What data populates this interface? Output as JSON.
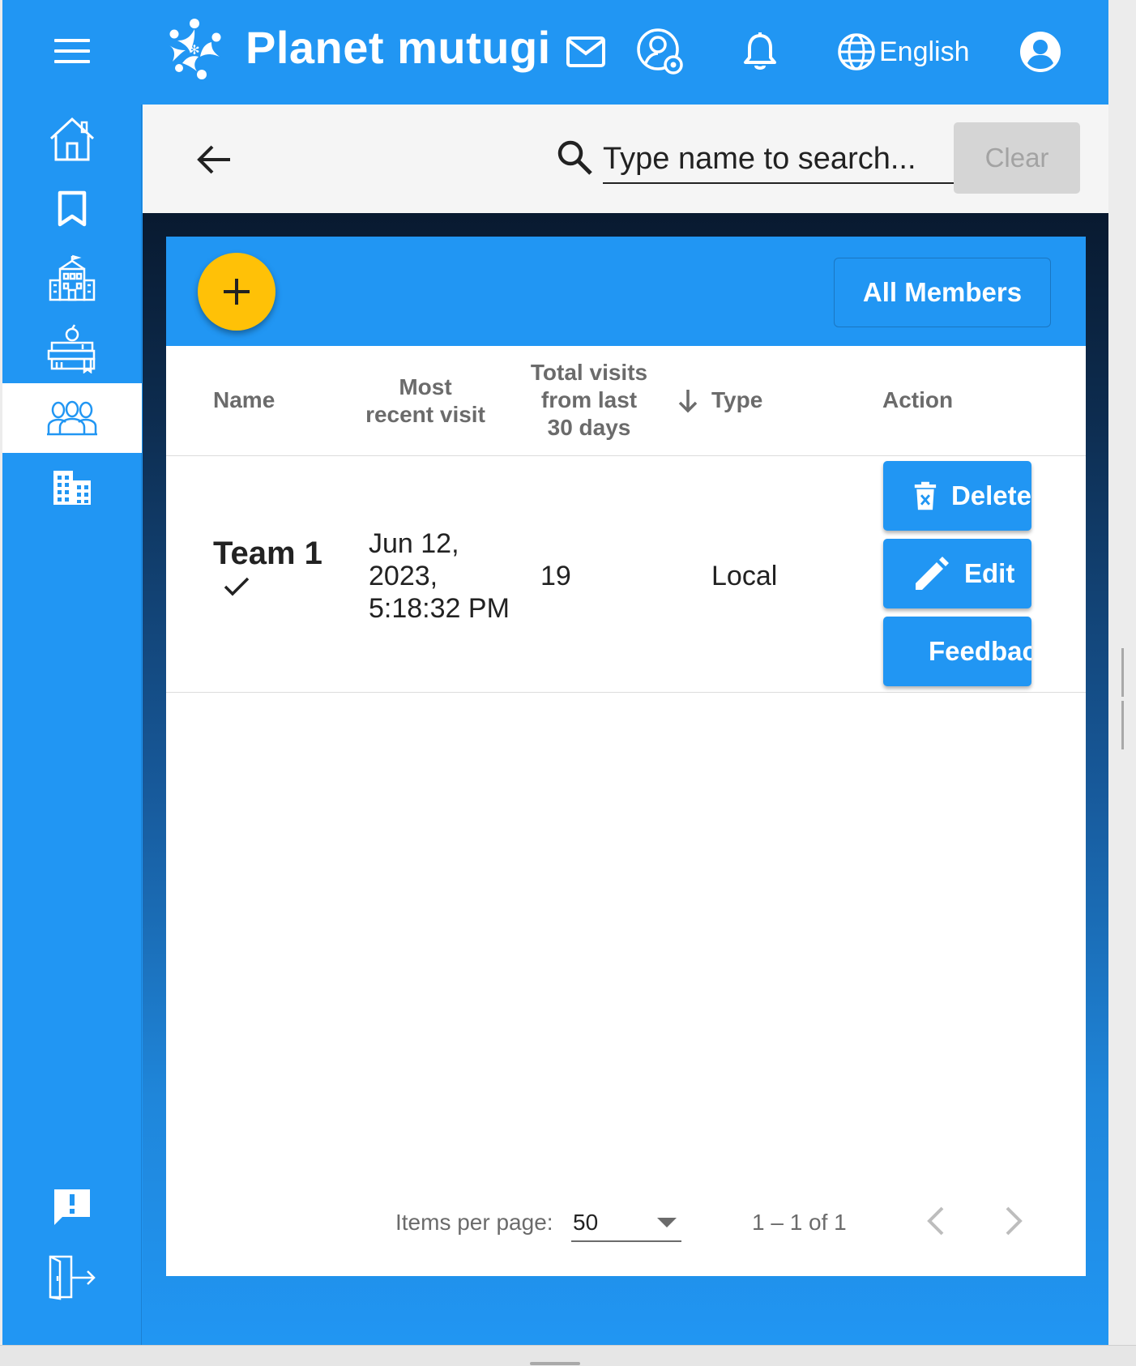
{
  "header": {
    "app_title": "Planet mutugi",
    "language": "English",
    "icons": [
      "menu-icon",
      "planet-logo-icon",
      "mail-icon",
      "user-settings-icon",
      "bell-icon",
      "globe-icon",
      "account-circle-icon"
    ]
  },
  "sidebar": {
    "items": [
      {
        "name": "home",
        "icon": "home-icon"
      },
      {
        "name": "library",
        "icon": "bookmark-icon"
      },
      {
        "name": "community",
        "icon": "school-building-icon"
      },
      {
        "name": "courses",
        "icon": "books-apple-icon"
      },
      {
        "name": "teams",
        "icon": "team-icon",
        "active": true
      },
      {
        "name": "enterprises",
        "icon": "office-building-icon"
      },
      {
        "name": "feedback",
        "icon": "feedback-icon"
      },
      {
        "name": "logout",
        "icon": "logout-icon"
      }
    ]
  },
  "search": {
    "placeholder": "Type name to search...",
    "clear_label": "Clear"
  },
  "card": {
    "all_members_label": "All Members"
  },
  "table": {
    "headers": {
      "name": "Name",
      "most_recent_visit_1": "Most",
      "most_recent_visit_2": "recent visit",
      "total_visits_1": "Total visits",
      "total_visits_2": "from last",
      "total_visits_3": "30 days",
      "type": "Type",
      "action": "Action"
    },
    "rows": [
      {
        "name": "Team 1",
        "visit_line1": "Jun 12,",
        "visit_line2": "2023,",
        "visit_line3": "5:18:32 PM",
        "total_visits": "19",
        "type": "Local",
        "actions": {
          "delete": "Delete",
          "edit": "Edit",
          "feedback": "Feedback"
        }
      }
    ]
  },
  "paginator": {
    "items_per_page_label": "Items per page:",
    "items_per_page_value": "50",
    "range_label": "1 – 1 of 1"
  },
  "colors": {
    "primary": "#2196f3",
    "accent": "#ffc107",
    "text": "#222222",
    "muted": "#6b6b6b"
  }
}
